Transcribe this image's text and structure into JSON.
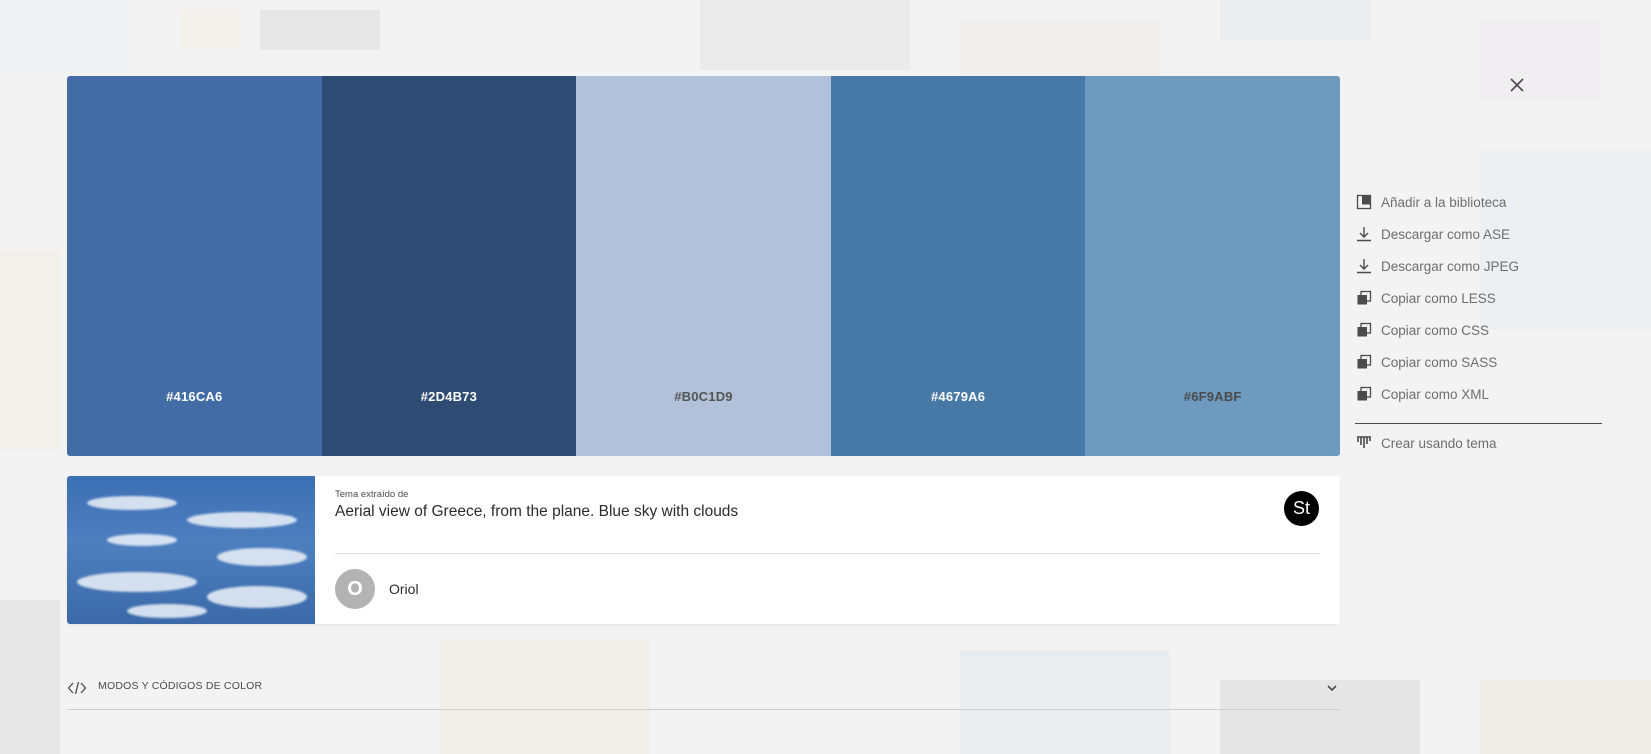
{
  "close": {
    "icon": "close-icon"
  },
  "palette": {
    "swatches": [
      {
        "hex": "#416CA6",
        "color": "#416CA6",
        "text_color": "#ffffff"
      },
      {
        "hex": "#2D4B73",
        "color": "#2D4B73",
        "text_color": "#ffffff"
      },
      {
        "hex": "#B0C1D9",
        "color": "#B0C1D9",
        "text_color": "#555555"
      },
      {
        "hex": "#4679A6",
        "color": "#4679A6",
        "text_color": "#ffffff"
      },
      {
        "hex": "#6F9ABF",
        "color": "#6F9ABF",
        "text_color": "#4a4a4a"
      }
    ]
  },
  "actions": [
    {
      "label": "Añadir a la biblioteca",
      "icon": "library-add-icon"
    },
    {
      "label": "Descargar como ASE",
      "icon": "download-icon"
    },
    {
      "label": "Descargar como JPEG",
      "icon": "download-icon"
    },
    {
      "label": "Copiar como LESS",
      "icon": "copy-icon"
    },
    {
      "label": "Copiar como CSS",
      "icon": "copy-icon"
    },
    {
      "label": "Copiar como SASS",
      "icon": "copy-icon"
    },
    {
      "label": "Copiar como XML",
      "icon": "copy-icon"
    }
  ],
  "create_action": {
    "label": "Crear usando tema",
    "icon": "create-theme-icon"
  },
  "source": {
    "label": "Tema extraído de",
    "title": "Aerial view of Greece, from the plane. Blue sky with clouds",
    "badge": "St",
    "author_initial": "O",
    "author": "Oriol"
  },
  "modes": {
    "label": "MODOS Y CÓDIGOS DE COLOR"
  }
}
